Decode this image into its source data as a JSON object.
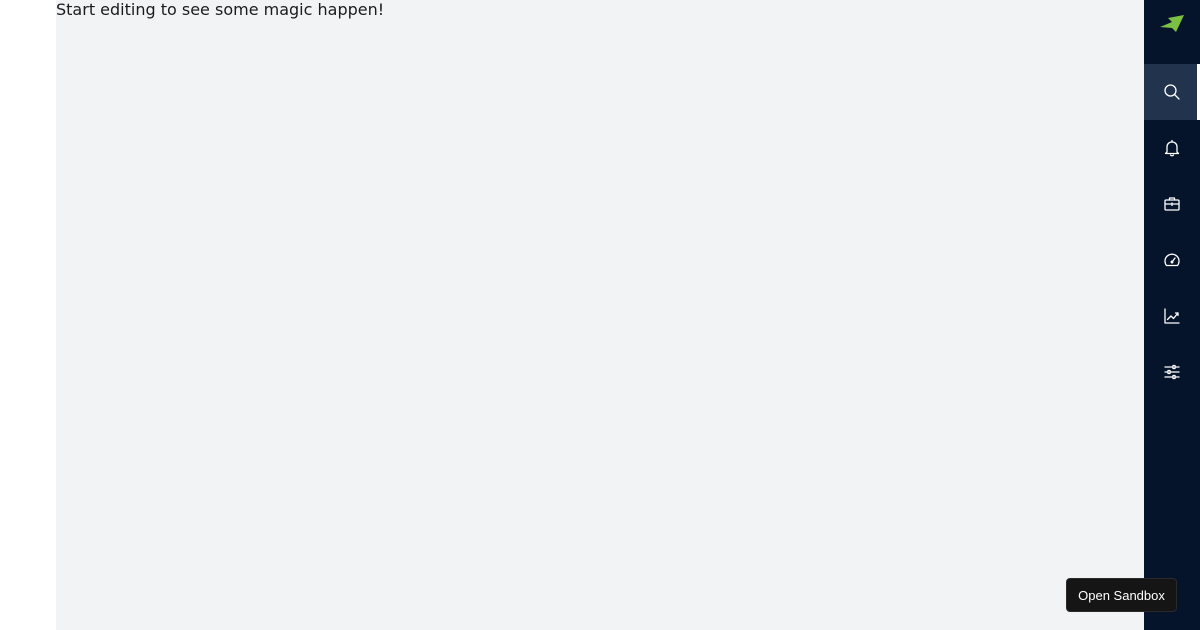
{
  "main": {
    "message": "Start editing to see some magic happen!"
  },
  "sidebar": {
    "logo_icon": "brand-arrow-logo",
    "logo_color": "#7cc043",
    "background_color": "#05132b",
    "active_item_color": "#22334e",
    "items": [
      {
        "id": "search",
        "icon": "search-icon",
        "active": true
      },
      {
        "id": "notifications",
        "icon": "bell-icon",
        "active": false
      },
      {
        "id": "portfolio",
        "icon": "briefcase-icon",
        "active": false
      },
      {
        "id": "dashboard",
        "icon": "speedometer-icon",
        "active": false
      },
      {
        "id": "analytics",
        "icon": "trend-chart-icon",
        "active": false
      },
      {
        "id": "settings",
        "icon": "sliders-icon",
        "active": false
      }
    ]
  },
  "sandbox_button": {
    "label": "Open Sandbox"
  }
}
